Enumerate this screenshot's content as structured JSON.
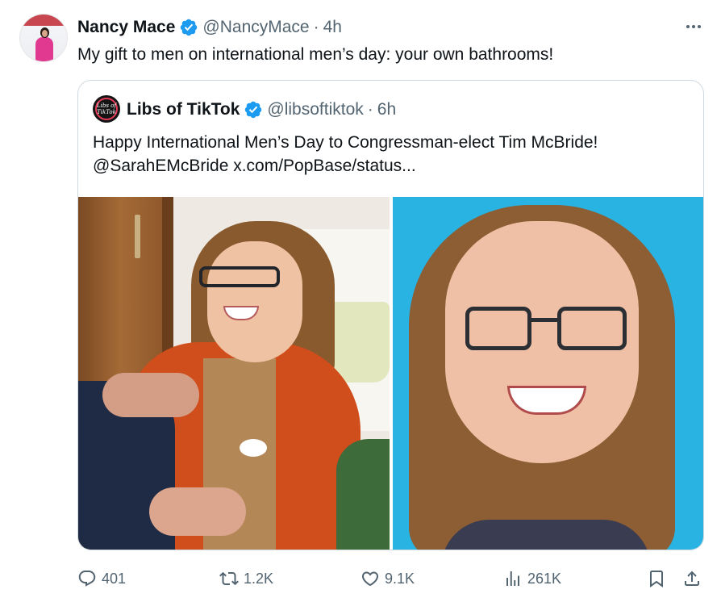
{
  "author": {
    "name": "Nancy Mace",
    "handle": "@NancyMace",
    "separator": "·",
    "time": "4h",
    "avatar_icon": "profile-photo"
  },
  "tweet": {
    "text": "My gift to men on international men’s day: your own bathrooms!"
  },
  "quoted": {
    "author": {
      "name": "Libs of TikTok",
      "handle": "@libsoftiktok",
      "separator": "·",
      "time": "6h",
      "avatar_label": "Libs of TikTok"
    },
    "text_line1": "Happy International Men’s Day to Congressman-elect Tim McBride!",
    "text_line2": "@SarahEMcBride  x.com/PopBase/status..."
  },
  "actions": {
    "replies": "401",
    "reposts": "1.2K",
    "likes": "9.1K",
    "views": "261K"
  },
  "colors": {
    "verified": "#1d9bf0",
    "muted": "#536471",
    "text": "#0f1419",
    "border": "#cfd9de"
  }
}
